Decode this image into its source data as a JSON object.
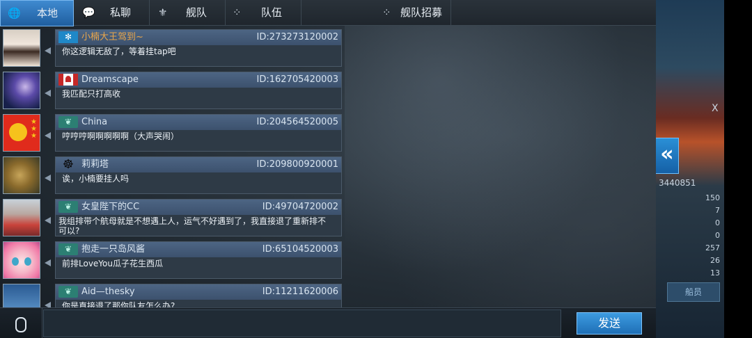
{
  "tabs": [
    {
      "label": "本地",
      "icon": "globe-icon",
      "glyph": "🌐",
      "active": true
    },
    {
      "label": "私聊",
      "icon": "chat-bubble-icon",
      "glyph": "💬",
      "active": false
    },
    {
      "label": "舰队",
      "icon": "fleet-emblem-icon",
      "glyph": "⚜",
      "active": false
    },
    {
      "label": "队伍",
      "icon": "team-dots-icon",
      "glyph": "⁘",
      "active": false
    },
    {
      "label": "舰队招募",
      "icon": "recruit-icon",
      "glyph": "⁘",
      "active": false
    }
  ],
  "messages": [
    {
      "name": "小楠大王驾到~",
      "id": "ID:273273120002",
      "text": "你这逻辑无敌了，等着挂tap吧",
      "flag": "snowflake-flag-icon"
    },
    {
      "name": "Dreamscape",
      "id": "ID:162705420003",
      "text": "我匹配只打高收",
      "flag": "canada-flag-icon"
    },
    {
      "name": "China",
      "id": "ID:204564520005",
      "text": "哼哼哼啊啊啊啊啊（大声哭闹）",
      "flag": "bird-flag-icon"
    },
    {
      "name": "莉莉塔",
      "id": "ID:209800920001",
      "text": "诶，小楠要挂人吗",
      "flag": "ship-wheel-flag-icon"
    },
    {
      "name": "女皇陛下的CC",
      "id": "ID:49704720002",
      "text": "我组排带个航母就是不想遇上人，运气不好遇到了，我直接退了重新排不可以?",
      "flag": "bird-flag-icon"
    },
    {
      "name": "抱走一只岛风酱",
      "id": "ID:65104520003",
      "text": "前排LoveYou瓜子花生西瓜",
      "flag": "bird-flag-icon"
    },
    {
      "name": "Aid—thesky",
      "id": "ID:11211620006",
      "text": "你是直接退了那你队友怎么办?",
      "flag": "bird-flag-icon"
    }
  ],
  "composer": {
    "value": "",
    "placeholder": "",
    "send_label": "发送"
  },
  "side_panel": {
    "collapse_glyph": "«",
    "id_text": "3440851",
    "close_glyph": "X",
    "stat_values": [
      "150",
      "7",
      "0",
      "0",
      "257",
      "26",
      "13"
    ],
    "member_button": "船员"
  }
}
